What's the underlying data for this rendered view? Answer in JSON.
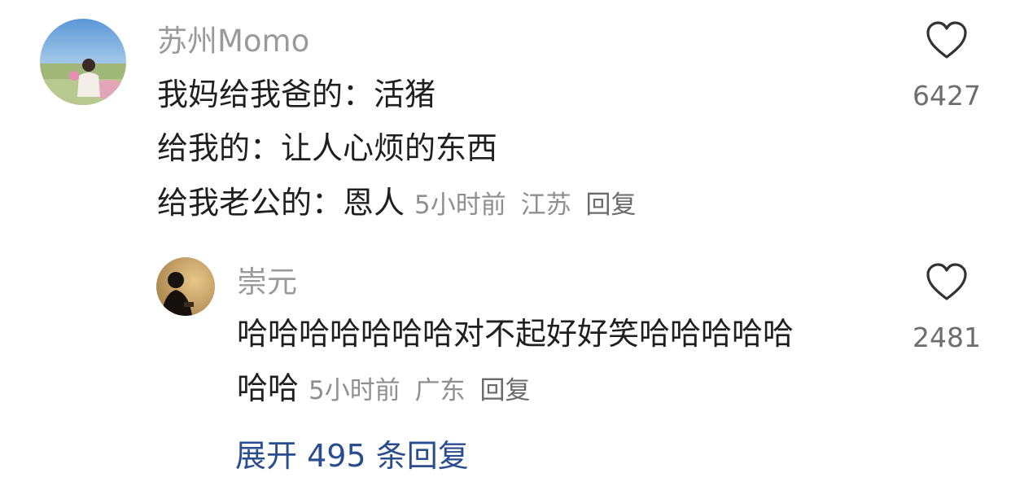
{
  "comment": {
    "username": "苏州Momo",
    "lines": [
      "我妈给我爸的：活猪",
      "给我的：让人心烦的东西",
      "给我老公的：恩人"
    ],
    "time": "5小时前",
    "location": "江苏",
    "reply_label": "回复",
    "likes": "6427",
    "like_icon": "heart-outline-icon",
    "reply": {
      "username": "崇元",
      "lines": [
        "哈哈哈哈哈哈哈对不起好好笑哈哈哈哈哈",
        "哈哈"
      ],
      "time": "5小时前",
      "location": "广东",
      "reply_label": "回复",
      "likes": "2481"
    },
    "expand_label": "展开 495 条回复"
  },
  "colors": {
    "username": "#9a9a9a",
    "meta": "#8f8f8f",
    "link": "#2a4d8f"
  }
}
